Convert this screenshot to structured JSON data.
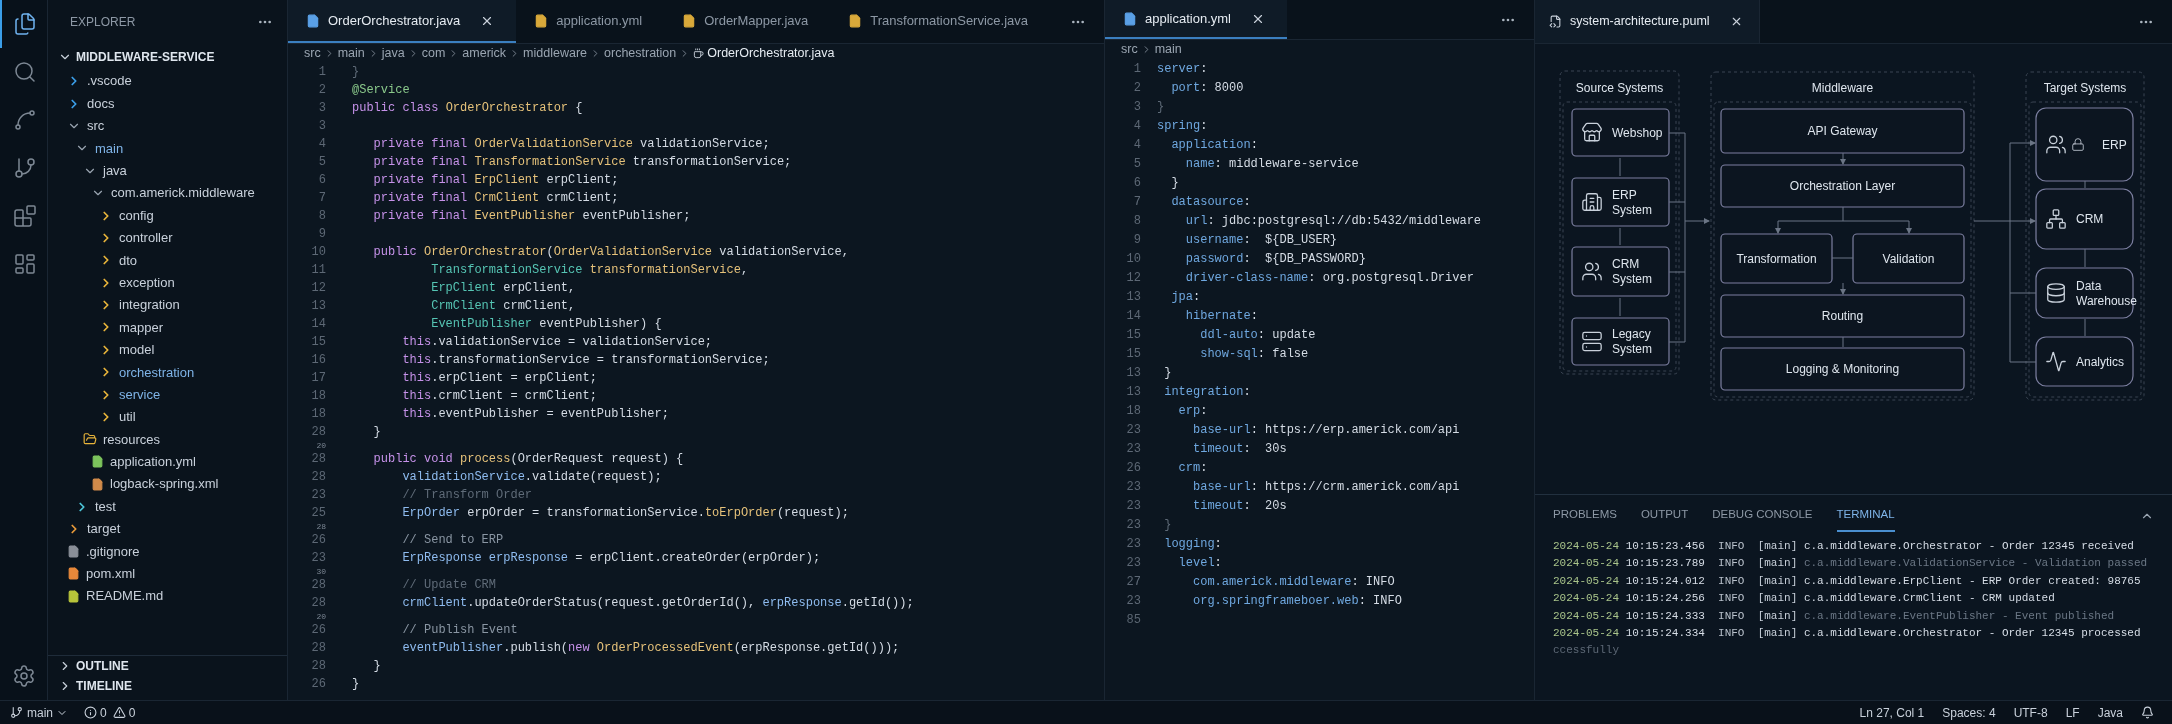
{
  "activity_bar": {
    "items": [
      {
        "kind": "files",
        "selected": true
      },
      {
        "kind": "search",
        "selected": false
      },
      {
        "kind": "nodes",
        "selected": false
      },
      {
        "kind": "branch",
        "selected": false
      },
      {
        "kind": "extensions",
        "selected": false
      },
      {
        "kind": "layout",
        "selected": false
      }
    ],
    "bottom": [
      {
        "kind": "settings"
      }
    ]
  },
  "sidebar": {
    "title": "EXPLORER",
    "root": {
      "label": "MIDDLEWARE-SERVICE",
      "expanded": true,
      "children": [
        {
          "label": ".vscode",
          "kind": "folder",
          "expanded": false,
          "color": "#3b9ee8",
          "highlight": false
        },
        {
          "label": "docs",
          "kind": "folder",
          "expanded": false,
          "color": "#3b9ee8",
          "highlight": false
        },
        {
          "label": "src",
          "kind": "folder",
          "expanded": true,
          "highlight": false,
          "children": [
            {
              "label": "main",
              "kind": "folder",
              "expanded": true,
              "highlight": true,
              "children": [
                {
                  "label": "java",
                  "kind": "folder",
                  "expanded": true,
                  "highlight": false,
                  "children": [
                    {
                      "label": "com.americk.middleware",
                      "kind": "folder",
                      "expanded": true,
                      "highlight": false,
                      "children": [
                        {
                          "label": "config",
                          "kind": "folder",
                          "expanded": false,
                          "color": "#e8b43a",
                          "highlight": false
                        },
                        {
                          "label": "controller",
                          "kind": "folder",
                          "expanded": false,
                          "color": "#e8b43a",
                          "highlight": false
                        },
                        {
                          "label": "dto",
                          "kind": "folder",
                          "expanded": false,
                          "color": "#e8b43a",
                          "highlight": false
                        },
                        {
                          "label": "exception",
                          "kind": "folder",
                          "expanded": false,
                          "color": "#e8b43a",
                          "highlight": false
                        },
                        {
                          "label": "integration",
                          "kind": "folder",
                          "expanded": false,
                          "color": "#e8b43a",
                          "highlight": false
                        },
                        {
                          "label": "mapper",
                          "kind": "folder",
                          "expanded": false,
                          "color": "#e8b43a",
                          "highlight": false
                        },
                        {
                          "label": "model",
                          "kind": "folder",
                          "expanded": false,
                          "color": "#e8b43a",
                          "highlight": false
                        },
                        {
                          "label": "orchestration",
                          "kind": "folder",
                          "expanded": false,
                          "color": "#e8b43a",
                          "highlight": true
                        },
                        {
                          "label": "service",
                          "kind": "folder",
                          "expanded": false,
                          "color": "#e8b43a",
                          "highlight": true
                        },
                        {
                          "label": "util",
                          "kind": "folder",
                          "expanded": false,
                          "color": "#e8b43a",
                          "highlight": false
                        }
                      ]
                    }
                  ]
                },
                {
                  "label": "resources",
                  "kind": "folder",
                  "expanded": true,
                  "color": "#e8b43a",
                  "highlight": false,
                  "children": [
                    {
                      "label": "application.yml",
                      "kind": "file",
                      "color": "#7cc35c",
                      "highlight": false
                    },
                    {
                      "label": "logback-spring.xml",
                      "kind": "file",
                      "color": "#d08a4a",
                      "highlight": false
                    }
                  ]
                }
              ]
            },
            {
              "label": "test",
              "kind": "folder",
              "expanded": false,
              "color": "#4dc6d8",
              "highlight": false
            }
          ]
        },
        {
          "label": "target",
          "kind": "folder",
          "expanded": false,
          "color": "#e89a3a",
          "highlight": false
        },
        {
          "label": ".gitignore",
          "kind": "file",
          "color": "#8a8f98",
          "highlight": false
        },
        {
          "label": "pom.xml",
          "kind": "file",
          "color": "#e8883a",
          "highlight": false
        },
        {
          "label": "README.md",
          "kind": "file",
          "color": "#b8c43a",
          "highlight": false
        }
      ]
    },
    "sections": [
      {
        "label": "OUTLINE",
        "expanded": false
      },
      {
        "label": "TIMELINE",
        "expanded": false
      }
    ]
  },
  "editors": [
    {
      "tabs": [
        {
          "label": "OrderOrchestrator.java",
          "selected": true,
          "color": "#5aa0e6"
        },
        {
          "label": "application.yml",
          "selected": false,
          "color": "#d9a93a"
        },
        {
          "label": "OrderMapper.java",
          "selected": false,
          "color": "#d9a93a"
        },
        {
          "label": "TransformationService.java",
          "selected": false,
          "color": "#d9a93a"
        }
      ],
      "breadcrumb": [
        "src",
        "main",
        "java",
        "com",
        "americk",
        "middleware",
        "orchestration",
        "OrderOrchestrator.java"
      ],
      "lines": [
        {
          "num": "1",
          "kind": "code",
          "tokens": [
            {
              "text": "}",
              "kind": "faded"
            }
          ]
        },
        {
          "num": "2",
          "kind": "code",
          "tokens": [
            {
              "text": "@Service",
              "kind": "annotation"
            }
          ]
        },
        {
          "num": "3",
          "kind": "code",
          "tokens": [
            {
              "text": "public class ",
              "kind": "keyword"
            },
            {
              "text": "OrderOrchestrator",
              "kind": "type"
            },
            {
              "text": " {",
              "kind": "plain"
            }
          ]
        },
        {
          "num": "3",
          "kind": "code"
        },
        {
          "num": "4",
          "kind": "code",
          "tokens": [
            {
              "text": "   private final ",
              "kind": "keyword"
            },
            {
              "text": "OrderValidationService",
              "kind": "type"
            },
            {
              "text": " validationService;",
              "kind": "plain"
            }
          ]
        },
        {
          "num": "5",
          "kind": "code",
          "tokens": [
            {
              "text": "   private final ",
              "kind": "keyword"
            },
            {
              "text": "TransformationService",
              "kind": "type"
            },
            {
              "text": " transformationService;",
              "kind": "plain"
            }
          ]
        },
        {
          "num": "6",
          "kind": "code",
          "tokens": [
            {
              "text": "   private final ",
              "kind": "keyword"
            },
            {
              "text": "ErpClient",
              "kind": "type"
            },
            {
              "text": " erpClient;",
              "kind": "plain"
            }
          ]
        },
        {
          "num": "7",
          "kind": "code",
          "tokens": [
            {
              "text": "   private final ",
              "kind": "keyword"
            },
            {
              "text": "CrmClient",
              "kind": "type"
            },
            {
              "text": " crmClient;",
              "kind": "plain"
            }
          ]
        },
        {
          "num": "8",
          "kind": "code",
          "tokens": [
            {
              "text": "   private final ",
              "kind": "keyword"
            },
            {
              "text": "EventPublisher",
              "kind": "type"
            },
            {
              "text": " eventPublisher;",
              "kind": "plain"
            }
          ]
        },
        {
          "num": "9",
          "kind": "code"
        },
        {
          "num": "10",
          "kind": "code",
          "tokens": [
            {
              "text": "   public ",
              "kind": "keyword"
            },
            {
              "text": "OrderOrchestrator",
              "kind": "type"
            },
            {
              "text": "(",
              "kind": "plain"
            },
            {
              "text": "OrderValidationService",
              "kind": "type"
            },
            {
              "text": " validationService,",
              "kind": "plain"
            }
          ]
        },
        {
          "num": "11",
          "kind": "code",
          "tokens": [
            {
              "text": "           TransformationService",
              "kind": "param"
            },
            {
              "text": " transformationService",
              "kind": "type"
            },
            {
              "text": ",",
              "kind": "plain"
            }
          ]
        },
        {
          "num": "12",
          "kind": "code",
          "tokens": [
            {
              "text": "           ErpClient",
              "kind": "param"
            },
            {
              "text": " erpClient,",
              "kind": "plain"
            }
          ]
        },
        {
          "num": "13",
          "kind": "code",
          "tokens": [
            {
              "text": "           CrmClient",
              "kind": "param"
            },
            {
              "text": " crmClient,",
              "kind": "plain"
            }
          ]
        },
        {
          "num": "14",
          "kind": "code",
          "tokens": [
            {
              "text": "           EventPublisher",
              "kind": "param"
            },
            {
              "text": " eventPublisher) {",
              "kind": "plain"
            }
          ]
        },
        {
          "num": "15",
          "kind": "code",
          "tokens": [
            {
              "text": "       this",
              "kind": "keyword"
            },
            {
              "text": ".validationService = validationService;",
              "kind": "plain"
            }
          ]
        },
        {
          "num": "16",
          "kind": "code",
          "tokens": [
            {
              "text": "       this",
              "kind": "keyword"
            },
            {
              "text": ".transformationService = transformationService;",
              "kind": "plain"
            }
          ]
        },
        {
          "num": "17",
          "kind": "code",
          "tokens": [
            {
              "text": "       this",
              "kind": "keyword"
            },
            {
              "text": ".erpClient = erpClient;",
              "kind": "plain"
            }
          ]
        },
        {
          "num": "18",
          "kind": "code",
          "tokens": [
            {
              "text": "       this",
              "kind": "keyword"
            },
            {
              "text": ".crmClient = crmClient;",
              "kind": "plain"
            }
          ]
        },
        {
          "num": "18",
          "kind": "code",
          "tokens": [
            {
              "text": "       this",
              "kind": "keyword"
            },
            {
              "text": ".eventPublisher = eventPublisher;",
              "kind": "plain"
            }
          ]
        },
        {
          "num": "28",
          "kind": "code",
          "tokens": [
            {
              "text": "   }",
              "kind": "plain"
            }
          ]
        },
        {
          "num": "20",
          "kind": "gap"
        },
        {
          "num": "28",
          "kind": "code",
          "tokens": [
            {
              "text": "   public void ",
              "kind": "keyword"
            },
            {
              "text": "process",
              "kind": "type"
            },
            {
              "text": "(OrderRequest request) {",
              "kind": "plain"
            }
          ]
        },
        {
          "num": "28",
          "kind": "code",
          "tokens": [
            {
              "text": "       validationService",
              "kind": "ident"
            },
            {
              "text": ".validate(request);",
              "kind": "plain"
            }
          ]
        },
        {
          "num": "23",
          "kind": "code",
          "tokens": [
            {
              "text": "       // Transform Order",
              "kind": "faded"
            }
          ]
        },
        {
          "num": "25",
          "kind": "code",
          "tokens": [
            {
              "text": "       ErpOrder",
              "kind": "ident"
            },
            {
              "text": " erpOrder = transformationService.",
              "kind": "plain"
            },
            {
              "text": "toErpOrder",
              "kind": "type"
            },
            {
              "text": "(request);",
              "kind": "plain"
            }
          ]
        },
        {
          "num": "28",
          "kind": "gap"
        },
        {
          "num": "26",
          "kind": "code",
          "tokens": [
            {
              "text": "       // Send to ERP",
              "kind": "comment"
            }
          ]
        },
        {
          "num": "23",
          "kind": "code",
          "tokens": [
            {
              "text": "       ErpResponse erpResponse",
              "kind": "ident"
            },
            {
              "text": " = erpClient.createOrder(erpOrder);",
              "kind": "plain"
            }
          ]
        },
        {
          "num": "30",
          "kind": "gap"
        },
        {
          "num": "28",
          "kind": "code",
          "tokens": [
            {
              "text": "       // Update CRM",
              "kind": "faded"
            }
          ]
        },
        {
          "num": "28",
          "kind": "code",
          "tokens": [
            {
              "text": "       crmClient",
              "kind": "ident"
            },
            {
              "text": ".updateOrderStatus(request.getOrderId(), ",
              "kind": "plain"
            },
            {
              "text": "erpResponse",
              "kind": "ident"
            },
            {
              "text": ".getId());",
              "kind": "plain"
            }
          ]
        },
        {
          "num": "20",
          "kind": "gap"
        },
        {
          "num": "26",
          "kind": "code",
          "tokens": [
            {
              "text": "       // Publish Event",
              "kind": "comment"
            }
          ]
        },
        {
          "num": "28",
          "kind": "code",
          "tokens": [
            {
              "text": "       eventPublisher",
              "kind": "ident"
            },
            {
              "text": ".publish(",
              "kind": "plain"
            },
            {
              "text": "new ",
              "kind": "keyword"
            },
            {
              "text": "OrderProcessedEvent",
              "kind": "type"
            },
            {
              "text": "(erpResponse.getId()));",
              "kind": "plain"
            }
          ]
        },
        {
          "num": "28",
          "kind": "code",
          "tokens": [
            {
              "text": "   }",
              "kind": "plain"
            }
          ]
        },
        {
          "num": "26",
          "kind": "code",
          "tokens": [
            {
              "text": "}",
              "kind": "plain"
            }
          ]
        }
      ]
    },
    {
      "tabs": [
        {
          "label": "application.yml",
          "selected": true,
          "color": "#5aa0e6"
        }
      ],
      "breadcrumb": [
        "src",
        "main"
      ],
      "lines": [
        {
          "num": "1",
          "kind": "code",
          "tokens": [
            {
              "text": "server",
              "kind": "key"
            },
            {
              "text": ":",
              "kind": "plain"
            }
          ]
        },
        {
          "num": "2",
          "kind": "code",
          "tokens": [
            {
              "text": "  port",
              "kind": "key"
            },
            {
              "text": ": 8000",
              "kind": "plain"
            }
          ]
        },
        {
          "num": "3",
          "kind": "code",
          "tokens": [
            {
              "text": "}",
              "kind": "faded"
            }
          ]
        },
        {
          "num": "4",
          "kind": "code",
          "tokens": [
            {
              "text": "spring",
              "kind": "key"
            },
            {
              "text": ":",
              "kind": "plain"
            }
          ]
        },
        {
          "num": "4",
          "kind": "code",
          "tokens": [
            {
              "text": "  application",
              "kind": "key"
            },
            {
              "text": ":",
              "kind": "plain"
            }
          ]
        },
        {
          "num": "5",
          "kind": "code",
          "tokens": [
            {
              "text": "    name",
              "kind": "key"
            },
            {
              "text": ": middleware-service",
              "kind": "plain"
            }
          ]
        },
        {
          "num": "6",
          "kind": "code",
          "tokens": [
            {
              "text": "  }",
              "kind": "plain"
            }
          ]
        },
        {
          "num": "7",
          "kind": "code",
          "tokens": [
            {
              "text": "  datasource",
              "kind": "key"
            },
            {
              "text": ":",
              "kind": "plain"
            }
          ]
        },
        {
          "num": "8",
          "kind": "code",
          "tokens": [
            {
              "text": "    url",
              "kind": "key"
            },
            {
              "text": ": jdbc:postgresql://db:5432/middleware",
              "kind": "plain"
            }
          ]
        },
        {
          "num": "9",
          "kind": "code",
          "tokens": [
            {
              "text": "    username",
              "kind": "key"
            },
            {
              "text": ":  ${DB_USER}",
              "kind": "plain"
            }
          ]
        },
        {
          "num": "10",
          "kind": "code",
          "tokens": [
            {
              "text": "    password",
              "kind": "key"
            },
            {
              "text": ":  ${DB_PASSWORD}",
              "kind": "plain"
            }
          ]
        },
        {
          "num": "12",
          "kind": "code",
          "tokens": [
            {
              "text": "    driver-class-name",
              "kind": "key"
            },
            {
              "text": ": org.postgresql.Driver",
              "kind": "plain"
            }
          ]
        },
        {
          "num": "13",
          "kind": "code",
          "tokens": [
            {
              "text": "  jpa",
              "kind": "key"
            },
            {
              "text": ":",
              "kind": "plain"
            }
          ]
        },
        {
          "num": "14",
          "kind": "code",
          "tokens": [
            {
              "text": "    hibernate",
              "kind": "key"
            },
            {
              "text": ":",
              "kind": "plain"
            }
          ]
        },
        {
          "num": "15",
          "kind": "code",
          "tokens": [
            {
              "text": "      ddl-auto",
              "kind": "key"
            },
            {
              "text": ": update",
              "kind": "plain"
            }
          ]
        },
        {
          "num": "15",
          "kind": "code",
          "tokens": [
            {
              "text": "      show-sql",
              "kind": "key"
            },
            {
              "text": ": false",
              "kind": "plain"
            }
          ]
        },
        {
          "num": "13",
          "kind": "code",
          "tokens": [
            {
              "text": " }",
              "kind": "plain"
            }
          ]
        },
        {
          "num": "13",
          "kind": "code",
          "tokens": [
            {
              "text": " integration",
              "kind": "key"
            },
            {
              "text": ":",
              "kind": "plain"
            }
          ]
        },
        {
          "num": "18",
          "kind": "code",
          "tokens": [
            {
              "text": "   erp",
              "kind": "key"
            },
            {
              "text": ":",
              "kind": "plain"
            }
          ]
        },
        {
          "num": "23",
          "kind": "code",
          "tokens": [
            {
              "text": "     base-url",
              "kind": "key"
            },
            {
              "text": ": https://erp.americk.com/api",
              "kind": "plain"
            }
          ]
        },
        {
          "num": "23",
          "kind": "code",
          "tokens": [
            {
              "text": "     timeout",
              "kind": "key"
            },
            {
              "text": ":  30s",
              "kind": "plain"
            }
          ]
        },
        {
          "num": "26",
          "kind": "code",
          "tokens": [
            {
              "text": "   crm",
              "kind": "key"
            },
            {
              "text": ":",
              "kind": "plain"
            }
          ]
        },
        {
          "num": "23",
          "kind": "code",
          "tokens": [
            {
              "text": "     base-url",
              "kind": "key"
            },
            {
              "text": ": https://crm.americk.com/api",
              "kind": "plain"
            }
          ]
        },
        {
          "num": "23",
          "kind": "code",
          "tokens": [
            {
              "text": "     timeout",
              "kind": "key"
            },
            {
              "text": ":  20s",
              "kind": "plain"
            }
          ]
        },
        {
          "num": "23",
          "kind": "code",
          "tokens": [
            {
              "text": " }",
              "kind": "faded"
            }
          ]
        },
        {
          "num": "23",
          "kind": "code",
          "tokens": [
            {
              "text": " logging",
              "kind": "key"
            },
            {
              "text": ":",
              "kind": "plain"
            }
          ]
        },
        {
          "num": "23",
          "kind": "code",
          "tokens": [
            {
              "text": "   level",
              "kind": "key"
            },
            {
              "text": ":",
              "kind": "plain"
            }
          ]
        },
        {
          "num": "27",
          "kind": "code",
          "tokens": [
            {
              "text": "     com.americk.middleware",
              "kind": "key"
            },
            {
              "text": ": INFO",
              "kind": "plain"
            }
          ]
        },
        {
          "num": "23",
          "kind": "code",
          "tokens": [
            {
              "text": "     org.springframeboer.web",
              "kind": "key"
            },
            {
              "text": ": INFO",
              "kind": "plain"
            }
          ]
        },
        {
          "num": "85",
          "kind": "faint"
        }
      ]
    }
  ],
  "diagram": {
    "tab": {
      "label": "system-architecture.puml",
      "selected": true
    },
    "groups": [
      {
        "title": "Source Systems",
        "nodes": [
          {
            "lines": [
              "Webshop"
            ]
          },
          {
            "lines": [
              "ERP",
              "System"
            ]
          },
          {
            "lines": [
              "CRM",
              "System"
            ]
          },
          {
            "lines": [
              "Legacy",
              "System"
            ]
          }
        ]
      },
      {
        "title": "Middleware",
        "nodes": [
          {
            "lines": [
              "API Gateway"
            ]
          },
          {
            "lines": [
              "Orchestration Layer"
            ]
          },
          {
            "lines": [
              "Transformation"
            ]
          },
          {
            "lines": [
              "Validation"
            ]
          },
          {
            "lines": [
              "Routing"
            ]
          },
          {
            "lines": [
              "Logging & Monitoring"
            ]
          }
        ]
      },
      {
        "title": "Target Systems",
        "nodes": [
          {
            "lines": [
              "ERP"
            ]
          },
          {
            "lines": [
              "CRM"
            ]
          },
          {
            "lines": [
              "Data",
              "Warehouse"
            ]
          },
          {
            "lines": [
              "Analytics"
            ]
          }
        ]
      }
    ]
  },
  "panel": {
    "tabs": [
      {
        "label": "PROBLEMS",
        "selected": false
      },
      {
        "label": "OUTPUT",
        "selected": false
      },
      {
        "label": "DEBUG CONSOLE",
        "selected": false
      },
      {
        "label": "TERMINAL",
        "selected": true
      }
    ],
    "lines": [
      {
        "date": "2024-05-24",
        "time": "10:15:23.456",
        "level": "INFO",
        "thread": "[main]",
        "logger": "c.a.middleware.Orchestrator",
        "message": "- Order 12345 received",
        "dim": false
      },
      {
        "date": "2024-05-24",
        "time": "10:15:23.789",
        "level": "INFO",
        "thread": "[main]",
        "logger": "c.a.middleware.ValidationService",
        "message": "- Validation passed",
        "dim": true
      },
      {
        "date": "2024-05-24",
        "time": "10:15:24.012",
        "level": "INFO",
        "thread": "[main]",
        "logger": "c.a.middleware.ErpClient",
        "message": "- ERP Order created: 98765",
        "dim": false
      },
      {
        "date": "2024-05-24",
        "time": "10:15:24.256",
        "level": "INFO",
        "thread": "[main]",
        "logger": "c.a.middleware.CrmClient",
        "message": "- CRM updated",
        "dim": false
      },
      {
        "date": "2024-05-24",
        "time": "10:15:24.333",
        "level": "INFO",
        "thread": "[main]",
        "logger": "c.a.middleware.EventPublisher",
        "message": "- Event published",
        "dim": true
      },
      {
        "date": "2024-05-24",
        "time": "10:15:24.334",
        "level": "INFO",
        "thread": "[main]",
        "logger": "c.a.middleware.Orchestrator",
        "message": "- Order 12345 processed",
        "dim": false
      }
    ],
    "trailing": "ccessfully"
  },
  "status_bar": {
    "branch": "main",
    "errors": "0",
    "warnings": "0",
    "items": [
      "Ln 27, Col 1",
      "Spaces: 4",
      "UTF-8",
      "LF",
      "Java"
    ]
  }
}
